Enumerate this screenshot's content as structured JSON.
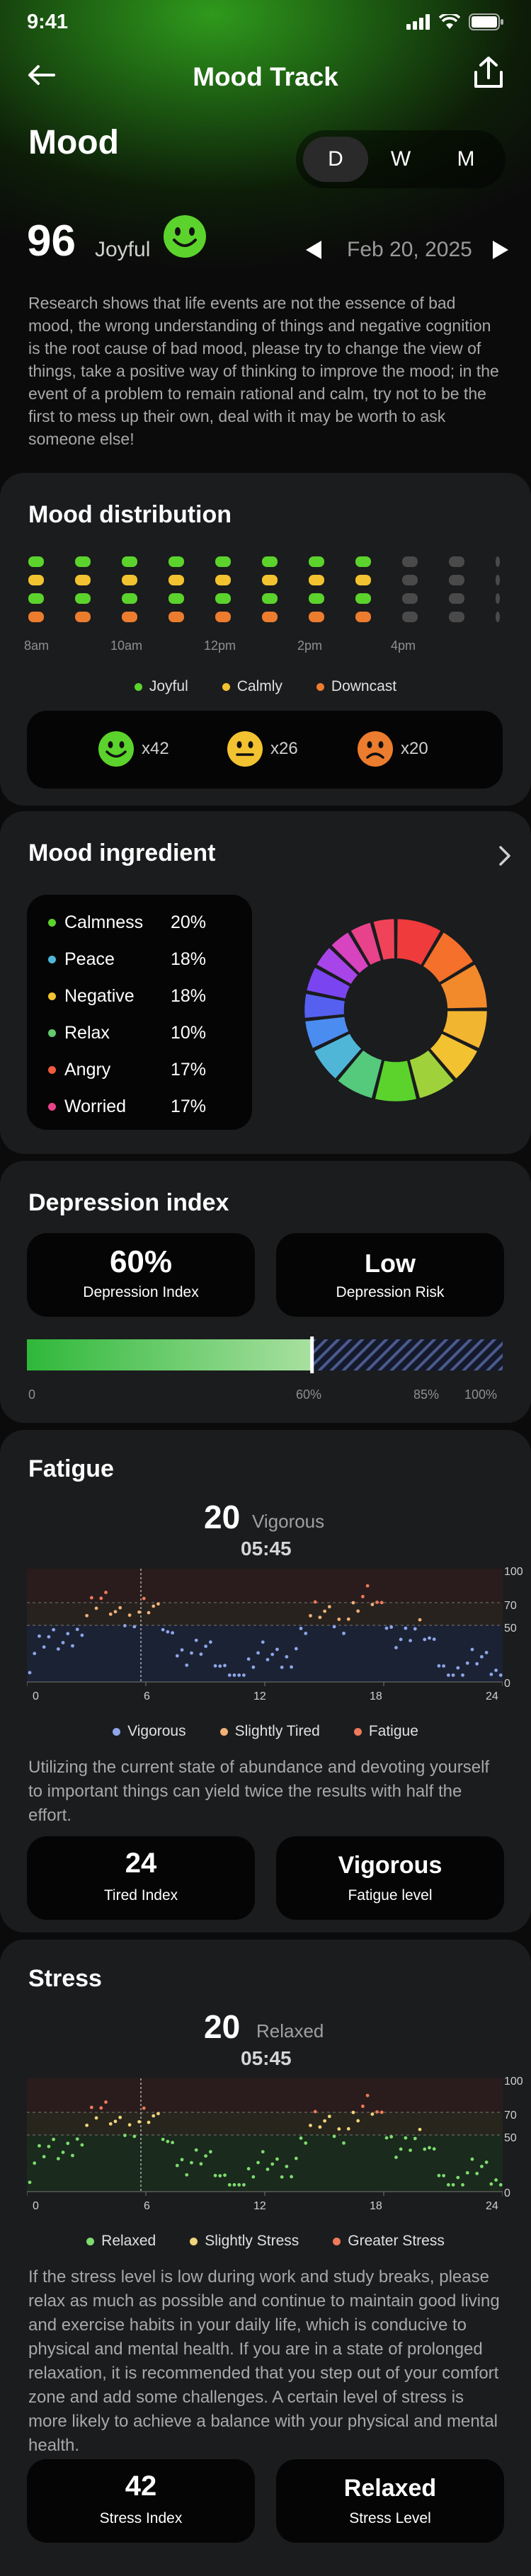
{
  "status_bar": {
    "time": "9:41"
  },
  "nav": {
    "title": "Mood Track"
  },
  "header": {
    "title": "Mood",
    "periods": [
      "D",
      "W",
      "M"
    ],
    "active_period": "D",
    "score": "96",
    "score_label": "Joyful",
    "date": "Feb 20, 2025",
    "intro": "Research shows that life events are not the essence of bad mood, the wrong understanding of things and negative cognition is the root cause of bad mood, please try to change the view of things, take a positive way of thinking to improve the mood; in the event of a problem to remain rational and calm, try not to be the first to mess up their own, deal with it may be worth to ask someone else!"
  },
  "colors": {
    "joyful": "#5bd32c",
    "calmly": "#f2c230",
    "downcast": "#ec7c2e",
    "empty": "#4a4a4a",
    "accent": "#3ecb3a"
  },
  "distribution": {
    "title": "Mood distribution",
    "time_labels": [
      "8am",
      "10am",
      "12pm",
      "2pm",
      "4pm"
    ],
    "legend": [
      "Joyful",
      "Calmly",
      "Downcast"
    ],
    "counts": [
      {
        "mood": "joyful",
        "value": "x42"
      },
      {
        "mood": "calmly",
        "value": "x26"
      },
      {
        "mood": "downcast",
        "value": "x20"
      }
    ]
  },
  "ingredient": {
    "title": "Mood ingredient",
    "items": [
      {
        "name": "Calmness",
        "pct": "20%",
        "value": 20,
        "color": "#5bd32c"
      },
      {
        "name": "Peace",
        "pct": "18%",
        "value": 18,
        "color": "#4fb6d8"
      },
      {
        "name": "Negative",
        "pct": "18%",
        "value": 18,
        "color": "#f2c230"
      },
      {
        "name": "Relax",
        "pct": "10%",
        "value": 10,
        "color": "#63c96e"
      },
      {
        "name": "Angry",
        "pct": "17%",
        "value": 17,
        "color": "#ef5b3b"
      },
      {
        "name": "Worried",
        "pct": "17%",
        "value": 17,
        "color": "#e8438a"
      }
    ]
  },
  "depression": {
    "title": "Depression index",
    "index_value": "60%",
    "index_label": "Depression Index",
    "risk_value": "Low",
    "risk_label": "Depression Risk",
    "progress": 60,
    "ticks": [
      "0",
      "60%",
      "85%",
      "100%"
    ]
  },
  "fatigue": {
    "title": "Fatigue",
    "value": "20",
    "value_word": "Vigorous",
    "time": "05:45",
    "x_ticks": [
      "0",
      "6",
      "12",
      "18",
      "24"
    ],
    "y_ticks": [
      "100",
      "70",
      "50",
      "0"
    ],
    "legend": [
      "Vigorous",
      "Slightly Tired",
      "Fatigue"
    ],
    "note": "Utilizing the current state of abundance and devoting yourself to important things can yield twice the results with half the effort.",
    "stat1_value": "24",
    "stat1_label": "Tired Index",
    "stat2_value": "Vigorous",
    "stat2_label": "Fatigue level"
  },
  "stress": {
    "title": "Stress",
    "value": "20",
    "value_word": "Relaxed",
    "time": "05:45",
    "x_ticks": [
      "0",
      "6",
      "12",
      "18",
      "24"
    ],
    "y_ticks": [
      "100",
      "70",
      "50",
      "0"
    ],
    "legend": [
      "Relaxed",
      "Slightly Stress",
      "Greater Stress"
    ],
    "note": "If the stress level is low during work and study breaks, please relax as much as possible and continue to maintain good living and exercise habits in your daily life, which is conducive to physical and mental health. If you are in a state of prolonged relaxation, it is recommended that you step out of your comfort zone and add some challenges. A certain level of stress is more likely to achieve a balance with your physical and mental health.",
    "stat1_value": "42",
    "stat1_label": "Stress Index",
    "stat2_value": "Relaxed",
    "stat2_label": "Stress Level"
  }
}
